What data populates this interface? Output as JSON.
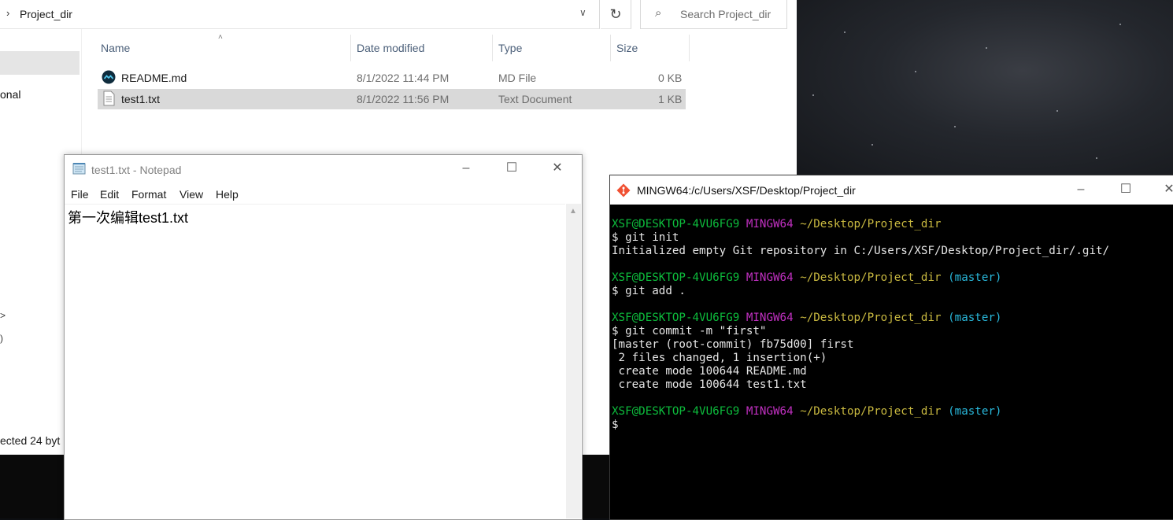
{
  "explorer": {
    "path": "Project_dir",
    "search_placeholder": "Search Project_dir",
    "nav_partial_1": "onal",
    "nav_partial_2": ">",
    "nav_partial_3": ")",
    "status": "ected  24 byt",
    "columns": [
      "Name",
      "Date modified",
      "Type",
      "Size"
    ],
    "files": [
      {
        "name": "README.md",
        "date": "8/1/2022 11:44 PM",
        "type": "MD File",
        "size": "0 KB",
        "icon": "markdown-icon",
        "selected": false
      },
      {
        "name": "test1.txt",
        "date": "8/1/2022 11:56 PM",
        "type": "Text Document",
        "size": "1 KB",
        "icon": "text-file-icon",
        "selected": true
      }
    ]
  },
  "notepad": {
    "title": "test1.txt - Notepad",
    "menu": [
      "File",
      "Edit",
      "Format",
      "View",
      "Help"
    ],
    "content": "第一次编辑test1.txt"
  },
  "terminal": {
    "title": "MINGW64:/c/Users/XSF/Desktop/Project_dir",
    "user": "XSF@DESKTOP-4VU6FG9",
    "env": "MINGW64",
    "cwd": "~/Desktop/Project_dir",
    "branch": "(master)",
    "cmd1": "$ git init",
    "out1": "Initialized empty Git repository in C:/Users/XSF/Desktop/Project_dir/.git/",
    "cmd2": "$ git add .",
    "cmd3": "$ git commit -m \"first\"",
    "out3a": "[master (root-commit) fb75d00] first",
    "out3b": " 2 files changed, 1 insertion(+)",
    "out3c": " create mode 100644 README.md",
    "out3d": " create mode 100644 test1.txt",
    "prompt": "$"
  },
  "colors": {
    "git_user": "#0dbc3c",
    "git_env": "#c130c1",
    "git_cwd": "#c9b940",
    "git_branch": "#29b8db"
  }
}
